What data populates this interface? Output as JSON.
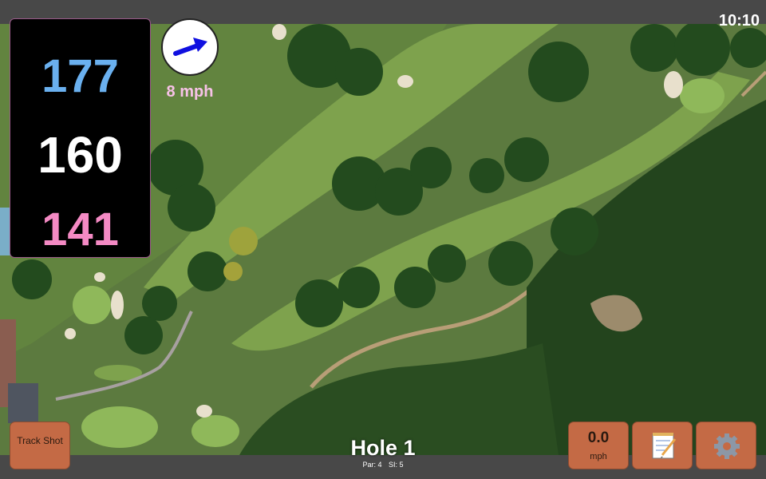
{
  "status": {
    "time": "10:10"
  },
  "yardage": {
    "back": "177",
    "middle": "160",
    "front": "141"
  },
  "wind": {
    "speed": "8 mph",
    "icon": "wind-arrow-icon"
  },
  "hole": {
    "title": "Hole 1",
    "par": "Par: 4",
    "stroke_index": "SI: 5"
  },
  "buttons": {
    "track_shot": "Track Shot",
    "speed_value": "0.0",
    "speed_unit": "mph",
    "notes_icon": "notepad-icon",
    "settings_icon": "gear-icon"
  },
  "colors": {
    "back_yardage": "#6ab0ef",
    "middle_yardage": "#ffffff",
    "front_yardage": "#f48ac4",
    "button": "#c46a45"
  }
}
